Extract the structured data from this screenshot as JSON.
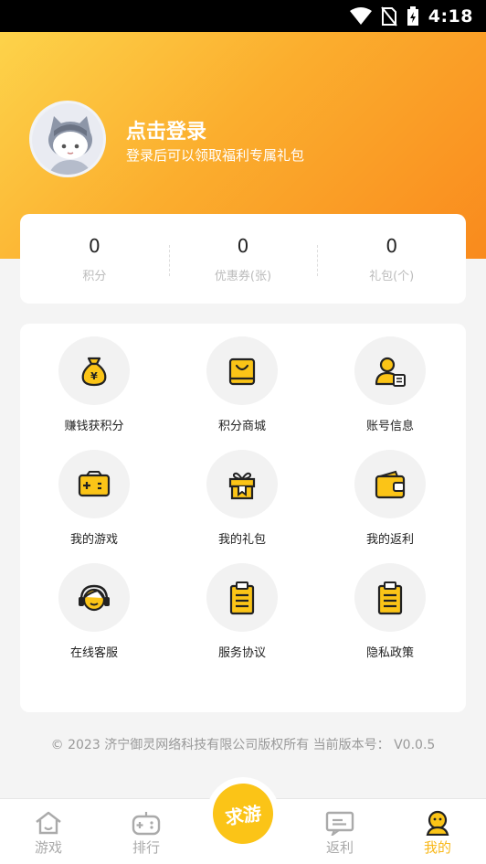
{
  "status_bar": {
    "time": "4:18"
  },
  "profile": {
    "title": "点击登录",
    "subtitle": "登录后可以领取福利专属礼包"
  },
  "stats": [
    {
      "value": "0",
      "label": "积分"
    },
    {
      "value": "0",
      "label": "优惠券(张)"
    },
    {
      "value": "0",
      "label": "礼包(个)"
    }
  ],
  "menu": [
    {
      "label": "赚钱获积分",
      "icon": "money-bag-icon"
    },
    {
      "label": "积分商城",
      "icon": "shopping-bag-icon"
    },
    {
      "label": "账号信息",
      "icon": "account-info-icon"
    },
    {
      "label": "我的游戏",
      "icon": "gamepad-icon"
    },
    {
      "label": "我的礼包",
      "icon": "gift-icon"
    },
    {
      "label": "我的返利",
      "icon": "wallet-icon"
    },
    {
      "label": "在线客服",
      "icon": "headset-icon"
    },
    {
      "label": "服务协议",
      "icon": "clipboard-icon"
    },
    {
      "label": "隐私政策",
      "icon": "clipboard-icon"
    }
  ],
  "footer": {
    "copyright": "© 2023 济宁御灵网络科技有限公司版权所有 当前版本号： V0.0.5"
  },
  "tabbar": {
    "items": [
      {
        "label": "游戏",
        "icon": "home-icon"
      },
      {
        "label": "排行",
        "icon": "gamepad-icon"
      },
      {
        "label": "返利",
        "icon": "message-icon"
      },
      {
        "label": "我的",
        "icon": "user-icon"
      }
    ],
    "center_label": "求游",
    "active": "我的"
  },
  "colors": {
    "accent": "#fbc417",
    "hero_start": "#fdd34a",
    "hero_end": "#f98a1d",
    "icon_dark": "#222222"
  }
}
